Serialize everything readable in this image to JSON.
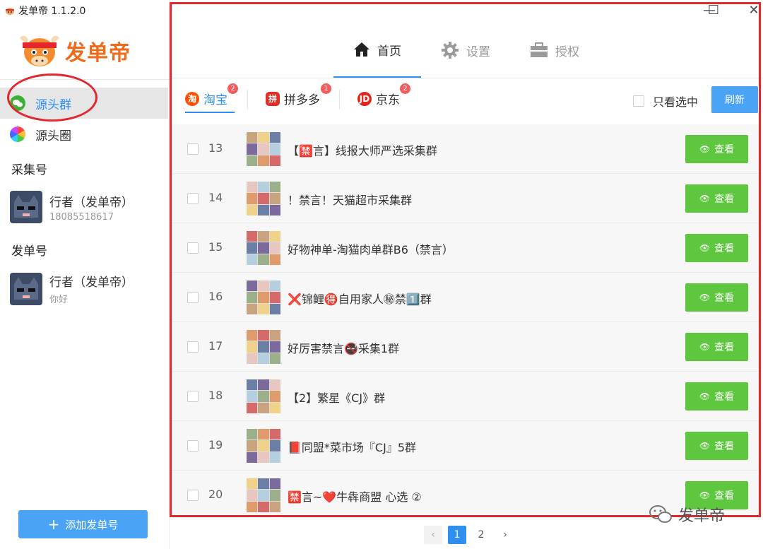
{
  "window": {
    "title": "发单帝 1.1.2.0"
  },
  "sidebar": {
    "logo_text": "发单帝",
    "nav": [
      {
        "label": "源头群",
        "icon": "wechat-icon",
        "active": true
      },
      {
        "label": "源头圈",
        "icon": "moments-icon",
        "active": false
      }
    ],
    "collect_label": "采集号",
    "collect_account": {
      "name": "行者（发单帝）",
      "sub": "18085518617"
    },
    "send_label": "发单号",
    "send_account": {
      "name": "行者（发单帝）",
      "sub": "你好"
    },
    "add_button": "添加发单号"
  },
  "top_tabs": [
    {
      "label": "首页",
      "icon": "home-icon",
      "active": true
    },
    {
      "label": "设置",
      "icon": "gear-icon",
      "active": false
    },
    {
      "label": "授权",
      "icon": "briefcase-icon",
      "active": false
    }
  ],
  "platform_tabs": [
    {
      "label": "淘宝",
      "badge": "2",
      "icon": "taobao-icon",
      "color": "#ff5000",
      "active": true
    },
    {
      "label": "拼多多",
      "badge": "1",
      "icon": "pinduoduo-icon",
      "color": "#e02e24",
      "active": false
    },
    {
      "label": "京东",
      "badge": "2",
      "icon": "jd-icon",
      "color": "#e1251b",
      "active": false
    }
  ],
  "only_selected_label": "只看选中",
  "refresh_button": "刷新",
  "view_button": "查看",
  "rows": [
    {
      "num": "13",
      "name": "【🈲言】线报大师严选采集群"
    },
    {
      "num": "14",
      "name": "！禁言！天猫超市采集群"
    },
    {
      "num": "15",
      "name": "好物神单-淘猫肉单群B6（禁言）"
    },
    {
      "num": "16",
      "name": "❌锦鲤🉐自用家人㊙禁1️⃣群"
    },
    {
      "num": "17",
      "name": "好厉害禁言🚭采集1群"
    },
    {
      "num": "18",
      "name": "【2】繁星《CJ》群"
    },
    {
      "num": "19",
      "name": "📕同盟*菜市场『CJ』5群"
    },
    {
      "num": "20",
      "name": "🈲言~❤️牛犇商盟 心选 ②"
    }
  ],
  "pagination": {
    "pages": [
      "1",
      "2"
    ],
    "current": "1"
  },
  "watermark": "发单帝",
  "colors": {
    "accent": "#2f8ff0",
    "view_green": "#5ec63f",
    "highlight_red": "#e4262d"
  }
}
